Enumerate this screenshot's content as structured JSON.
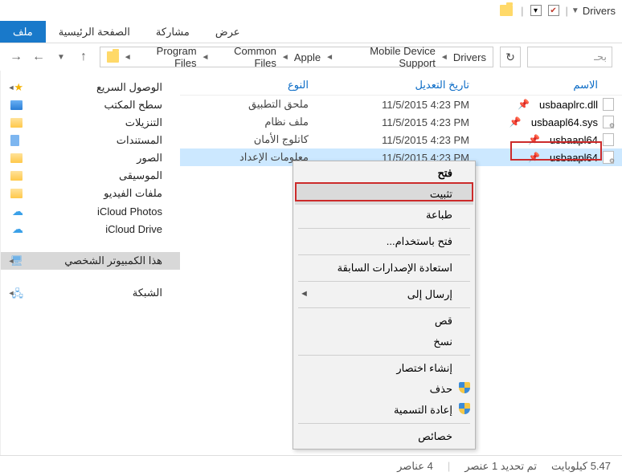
{
  "title": "Drivers",
  "tabs": {
    "file": "ملف",
    "home": "الصفحة الرئيسية",
    "share": "مشاركة",
    "view": "عرض"
  },
  "breadcrumb": [
    "Program Files",
    "Common Files",
    "Apple",
    "Mobile Device Support",
    "Drivers"
  ],
  "search_placeholder": "بحـ",
  "sidebar": {
    "quick_access": "الوصول السريع",
    "desktop": "سطح المكتب",
    "downloads": "التنزيلات",
    "documents": "المستندات",
    "pictures": "الصور",
    "music": "الموسيقى",
    "videos": "ملفات الفيديو",
    "icloud_photos": "iCloud Photos",
    "icloud_drive": "iCloud Drive",
    "this_pc": "هذا الكمبيوتر الشخصي",
    "network": "الشبكة"
  },
  "columns": {
    "name": "الاسم",
    "date": "تاريخ التعديل",
    "type": "النوع"
  },
  "files": [
    {
      "name": "usbaaplrc.dll",
      "date": "11/5/2015 4:23 PM",
      "type": "ملحق التطبيق"
    },
    {
      "name": "usbaapl64.sys",
      "date": "11/5/2015 4:23 PM",
      "type": "ملف نظام"
    },
    {
      "name": "usbaapl64",
      "date": "11/5/2015 4:23 PM",
      "type": "كاتلوج الأمان"
    },
    {
      "name": "usbaapl64",
      "date": "11/5/2015 4:23 PM",
      "type": "معلومات الإعداد"
    }
  ],
  "context_menu": {
    "open": "فتح",
    "install": "تثبيت",
    "print": "طباعة",
    "open_with": "فتح باستخدام...",
    "restore_prev": "استعادة الإصدارات السابقة",
    "send_to": "إرسال إلى",
    "cut": "قص",
    "copy": "نسخ",
    "create_shortcut": "إنشاء اختصار",
    "delete": "حذف",
    "rename": "إعادة التسمية",
    "properties": "خصائص"
  },
  "statusbar": {
    "items": "4 عناصر",
    "selected": "تم تحديد 1 عنصر",
    "size": "5.47 كيلوبايت"
  }
}
